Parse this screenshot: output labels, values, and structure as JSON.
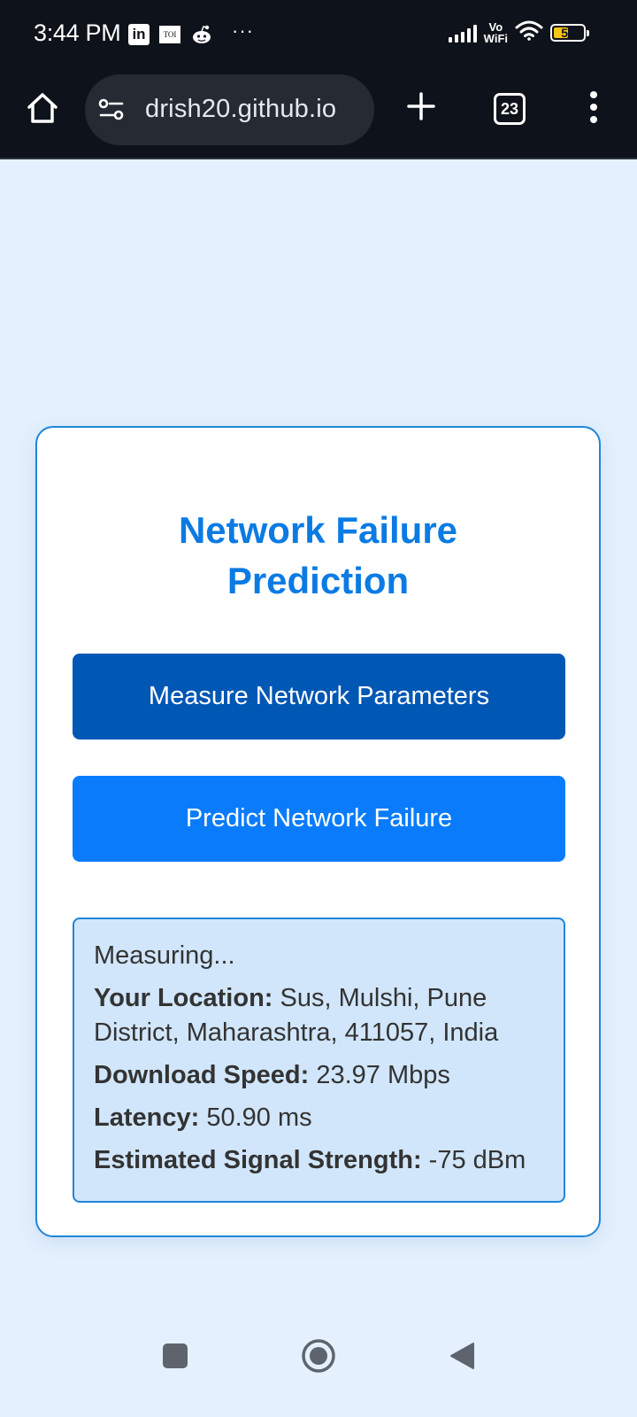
{
  "status_bar": {
    "time": "3:44 PM",
    "notification_icons": [
      "linkedin-icon",
      "toi-icon",
      "reddit-icon"
    ],
    "linkedin_label": "in",
    "toi_label": "TOI",
    "more_label": "···",
    "vowifi_label": "Vo\nWiFi",
    "battery_level": "51",
    "battery_fraction": 0.51
  },
  "browser": {
    "url": "drish20.github.io",
    "tab_count": "23"
  },
  "card": {
    "title": "Network Failure Prediction",
    "measure_button_label": "Measure Network Parameters",
    "predict_button_label": "Predict Network Failure",
    "results": {
      "status": "Measuring...",
      "location_label": "Your Location:",
      "location_value": "Sus, Mulshi, Pune District, Maharashtra, 411057, India",
      "download_label": "Download Speed:",
      "download_value": "23.97 Mbps",
      "latency_label": "Latency:",
      "latency_value": "50.90 ms",
      "signal_label": "Estimated Signal Strength:",
      "signal_value": "-75 dBm"
    }
  },
  "colors": {
    "page_background": "#e4f0fd",
    "title": "#0b7be3",
    "measure_button": "#0157b4",
    "predict_button": "#0a7cfb",
    "results_background": "#d1e6fb",
    "card_border": "#1e86d8"
  }
}
